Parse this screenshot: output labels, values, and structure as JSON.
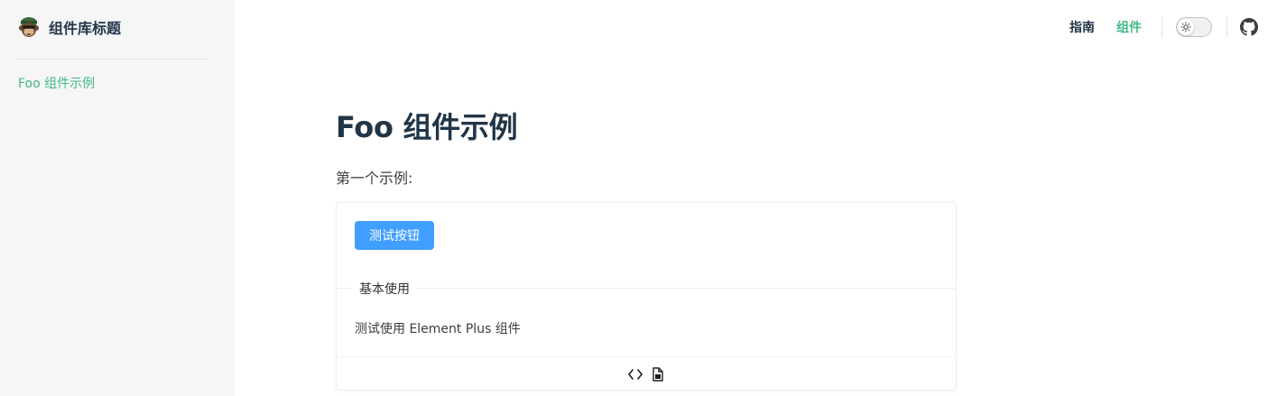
{
  "site": {
    "title": "组件库标题",
    "logo_icon": "monkey-logo-icon"
  },
  "sidebar": {
    "items": [
      {
        "label": "Foo 组件示例",
        "active": true
      }
    ]
  },
  "nav": {
    "links": [
      {
        "label": "指南",
        "active": false
      },
      {
        "label": "组件",
        "active": true
      }
    ],
    "toggle_icon": "sun-icon",
    "github_icon": "github-icon"
  },
  "page": {
    "title": "Foo 组件示例",
    "intro": "第一个示例:",
    "demo": {
      "button_label": "测试按钮",
      "divider_label": "基本使用",
      "description": "测试使用 Element Plus 组件",
      "actions": [
        "code-icon",
        "copy-icon"
      ]
    }
  },
  "colors": {
    "brand": "#42b883",
    "primary_button": "#409eff",
    "sidebar_bg": "#f6f6f7",
    "text": "#213547"
  }
}
